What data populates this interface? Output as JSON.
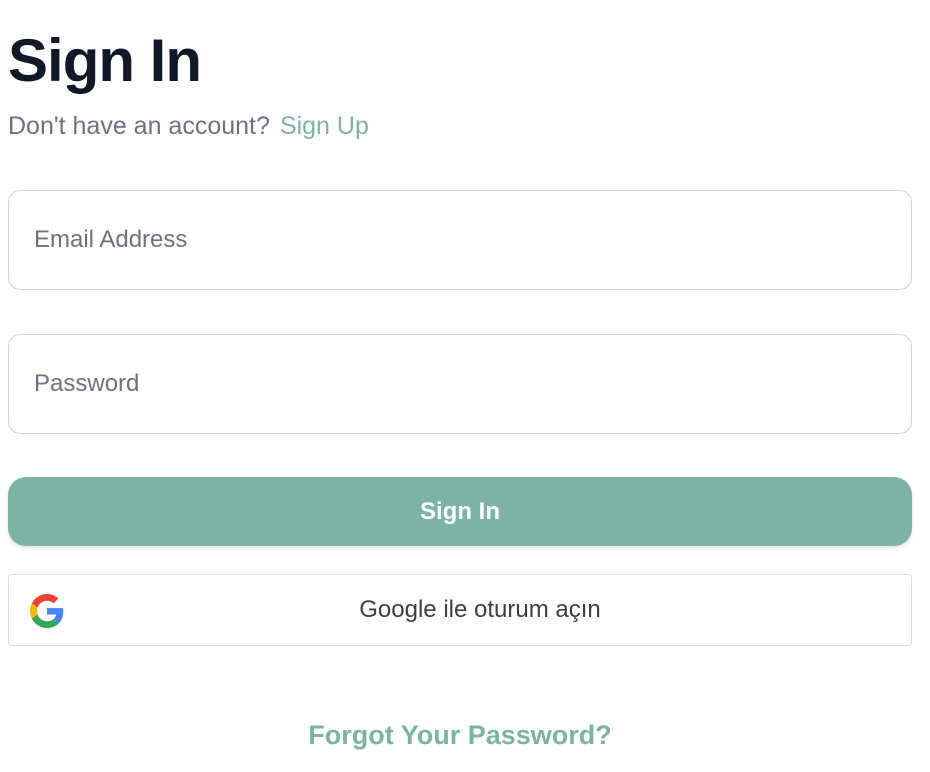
{
  "page": {
    "title": "Sign In"
  },
  "signup_prompt": {
    "text": "Don't have an account?",
    "link_label": "Sign Up"
  },
  "form": {
    "email": {
      "value": "",
      "placeholder": "Email Address"
    },
    "password": {
      "value": "",
      "placeholder": "Password"
    },
    "submit_label": "Sign In"
  },
  "google_button": {
    "label": "Google ile oturum açın",
    "icon": "google-icon"
  },
  "forgot_password": {
    "label": "Forgot Your Password?"
  },
  "colors": {
    "accent": "#7db3a5",
    "title": "#111827",
    "muted": "#6b7280",
    "border": "#cfd2d6"
  }
}
